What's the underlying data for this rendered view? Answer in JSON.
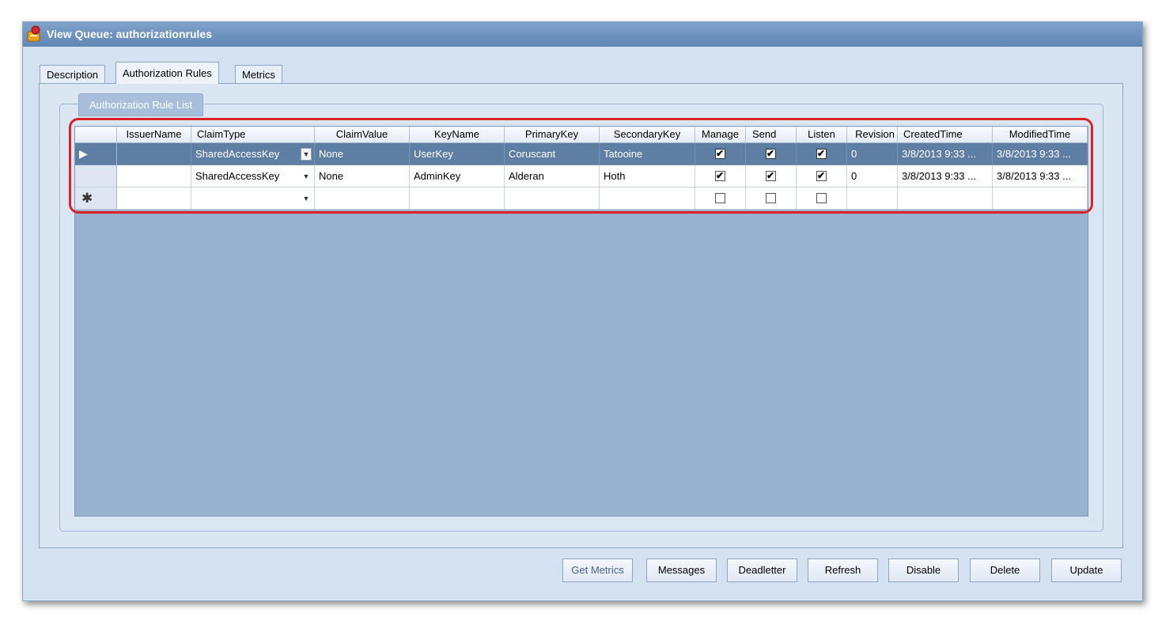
{
  "window": {
    "title": "View Queue: authorizationrules"
  },
  "tabs": [
    {
      "label": "Description",
      "active": false
    },
    {
      "label": "Authorization Rules",
      "active": true
    },
    {
      "label": "Metrics",
      "active": false
    }
  ],
  "group": {
    "caption": "Authorization Rule List"
  },
  "grid": {
    "columns": [
      "IssuerName",
      "ClaimType",
      "ClaimValue",
      "KeyName",
      "PrimaryKey",
      "SecondaryKey",
      "Manage",
      "Send",
      "Listen",
      "Revision",
      "CreatedTime",
      "ModifiedTime"
    ],
    "rows": [
      {
        "selected": true,
        "IssuerName": "",
        "ClaimType": "SharedAccessKey",
        "ClaimValue": "None",
        "KeyName": "UserKey",
        "PrimaryKey": "Coruscant",
        "SecondaryKey": "Tatooine",
        "Manage": true,
        "Send": true,
        "Listen": true,
        "Revision": "0",
        "CreatedTime": "3/8/2013 9:33 ...",
        "ModifiedTime": "3/8/2013 9:33 ..."
      },
      {
        "selected": false,
        "IssuerName": "",
        "ClaimType": "SharedAccessKey",
        "ClaimValue": "None",
        "KeyName": "AdminKey",
        "PrimaryKey": "Alderan",
        "SecondaryKey": "Hoth",
        "Manage": true,
        "Send": true,
        "Listen": true,
        "Revision": "0",
        "CreatedTime": "3/8/2013 9:33 ...",
        "ModifiedTime": "3/8/2013 9:33 ..."
      }
    ],
    "new_row_glyph": "✱",
    "current_row_glyph": "▶",
    "check_glyph": "✔",
    "dropdown_glyph": "▼"
  },
  "buttons": {
    "get_metrics": "Get Metrics",
    "messages": "Messages",
    "deadletter": "Deadletter",
    "refresh": "Refresh",
    "disable": "Disable",
    "delete": "Delete",
    "update": "Update"
  },
  "colors": {
    "titlebar": "#6a8fbb",
    "selected_row": "#5f7ea4",
    "highlight": "#d9232a",
    "grid_background": "#98b1ce"
  }
}
